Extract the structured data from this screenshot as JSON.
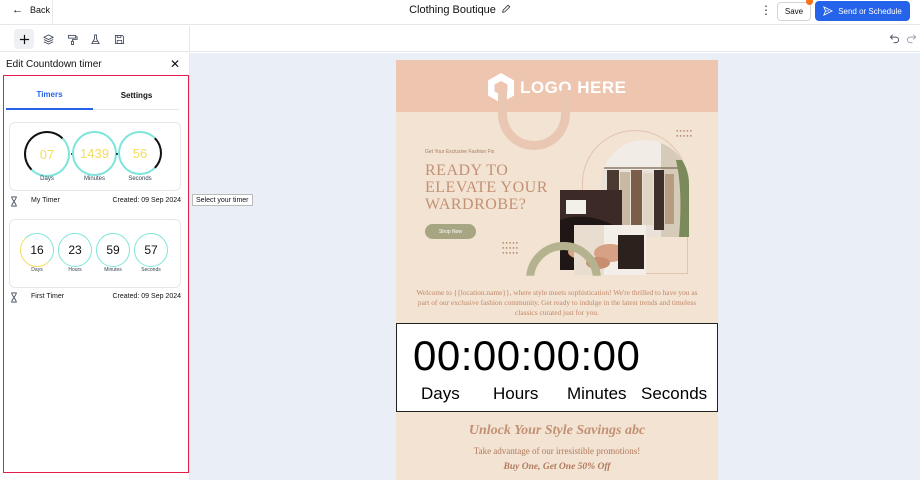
{
  "topbar": {
    "back_label": "Back",
    "title": "Clothing Boutique",
    "save_label": "Save",
    "send_label": "Send or Schedule"
  },
  "panel": {
    "title": "Edit Countdown timer",
    "tabs": [
      {
        "label": "Timers",
        "active": true
      },
      {
        "label": "Settings",
        "active": false
      }
    ],
    "timers": [
      {
        "name": "My Timer",
        "created": "Created: 09 Sep 2024",
        "units": [
          {
            "value": "07",
            "label": "Days"
          },
          {
            "value": "1439",
            "label": "Minutes"
          },
          {
            "value": "56",
            "label": "Seconds"
          }
        ]
      },
      {
        "name": "First Timer",
        "created": "Created: 09 Sep 2024",
        "units": [
          {
            "value": "16",
            "label": "Days"
          },
          {
            "value": "23",
            "label": "Hours"
          },
          {
            "value": "59",
            "label": "Minutes"
          },
          {
            "value": "57",
            "label": "Seconds"
          }
        ]
      }
    ]
  },
  "canvas": {
    "tooltip": "Select your timer"
  },
  "email": {
    "logo_text": "LOGO HERE",
    "kicker": "Get Your Exclusive Fashion Fix",
    "headline": "READY TO ELEVATE YOUR WARDROBE?",
    "shop_button": "Shop Now",
    "welcome": "Welcome to {{location.name}}, where style meets sophistication! We're thrilled to have you as part of our exclusive fashion community. Get ready to indulge in the latest trends and timeless classics curated just for you.",
    "countdown": {
      "digits": "00:00:00:00",
      "labels": [
        "Days",
        "Hours",
        "Minutes",
        "Seconds"
      ]
    },
    "unlock_title": "Unlock Your Style Savings abc",
    "advantage": "Take advantage of our irresistible promotions!",
    "bogo": "Buy One, Get One 50% Off"
  },
  "colors": {
    "accent": "#2563eb",
    "panel_frame": "#e11d48",
    "ring": "#7fe5dc",
    "ring_progress": "#f6dc5c",
    "email_bg": "#f3e3d3",
    "email_header": "#eec6b0"
  }
}
